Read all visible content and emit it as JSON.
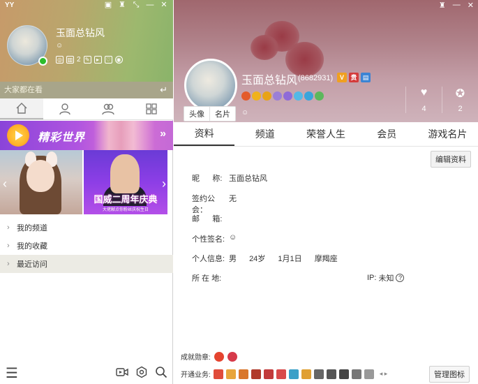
{
  "left": {
    "app_title": "YY",
    "window_controls": [
      "skin-icon",
      "shirt-icon",
      "compact-icon",
      "minimize-icon",
      "close-icon"
    ],
    "user": {
      "name": "玉面总钻风",
      "signature": "☺",
      "gift_count": "2"
    },
    "search": {
      "placeholder": "大家都在看"
    },
    "tabs": [
      "home-icon",
      "contact-icon",
      "group-icon",
      "apps-icon"
    ],
    "banner": {
      "text": "精彩世界"
    },
    "thumb2_title": "国威二周年庆典",
    "thumb2_sub": "大佬献点你粉丝庆祝生日",
    "list": [
      {
        "label": "我的频道"
      },
      {
        "label": "我的收藏"
      },
      {
        "label": "最近访问"
      }
    ]
  },
  "right": {
    "name": "玉面总钻风",
    "uid": "(8682931)",
    "signature": "☺",
    "avatar_tabs": [
      "头像",
      "名片"
    ],
    "stats": [
      {
        "icon": "heart-icon",
        "value": "4"
      },
      {
        "icon": "medal-icon",
        "value": "2"
      }
    ],
    "tabs": [
      "资料",
      "频道",
      "荣誉人生",
      "会员",
      "游戏名片"
    ],
    "edit_button": "编辑资料",
    "profile": {
      "nickname_label": "昵      称:",
      "nickname": "玉面总钻风",
      "guild_label": "签约公会：",
      "guild": "无",
      "email_label": "邮      箱:",
      "email": "",
      "signature_label": "个性签名:",
      "signature": "☺",
      "info_label": "个人信息:",
      "gender": "男",
      "age": "24岁",
      "birthday": "1月1日",
      "zodiac": "摩羯座",
      "location_label": "所 在 地:",
      "location": "",
      "ip_label": "IP:",
      "ip": "未知"
    },
    "achieve_label": "成就勋章:",
    "services_label": "开通业务:",
    "manage_button": "管理图标",
    "colors": {
      "accent": "#333333",
      "header_top": "#a0676e",
      "left_header": "#9db86e"
    }
  }
}
